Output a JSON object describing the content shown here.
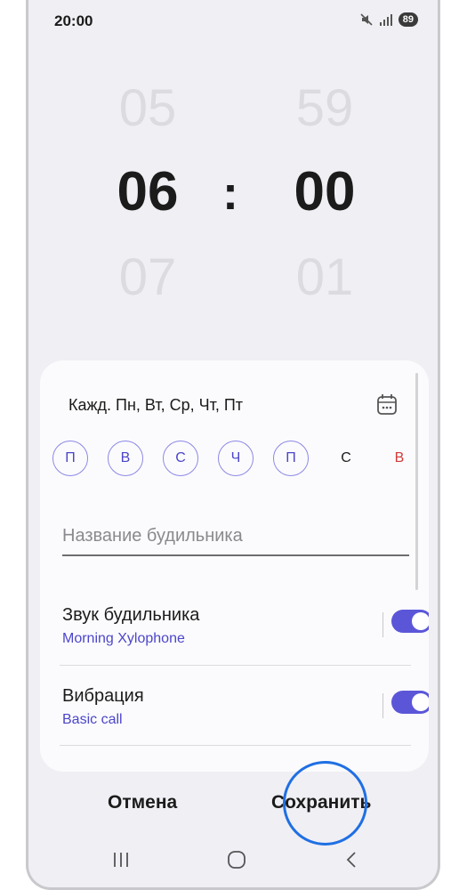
{
  "status_bar": {
    "time": "20:00",
    "battery": "89",
    "icons": [
      "mute-icon",
      "signal-icon",
      "battery-icon"
    ]
  },
  "time_picker": {
    "hours": {
      "prev": "05",
      "current": "06",
      "next": "07"
    },
    "separator": ":",
    "minutes": {
      "prev": "59",
      "current": "00",
      "next": "01"
    }
  },
  "repeat": {
    "summary": "Кажд. Пн, Вт, Ср, Чт, Пт",
    "calendar_icon": "calendar-icon"
  },
  "days": [
    {
      "label": "П",
      "selected": true
    },
    {
      "label": "В",
      "selected": true
    },
    {
      "label": "С",
      "selected": true
    },
    {
      "label": "Ч",
      "selected": true
    },
    {
      "label": "П",
      "selected": true
    },
    {
      "label": "С",
      "selected": false
    },
    {
      "label": "В",
      "selected": false
    }
  ],
  "alarm_name": {
    "placeholder": "Название будильника",
    "value": ""
  },
  "settings": [
    {
      "title": "Звук будильника",
      "subtitle": "Morning Xylophone",
      "enabled": true
    },
    {
      "title": "Вибрация",
      "subtitle": "Basic call",
      "enabled": true
    }
  ],
  "actions": {
    "cancel": "Отмена",
    "save": "Сохранить"
  },
  "navbar": {
    "icons": [
      "recent-apps-icon",
      "home-icon",
      "back-icon"
    ]
  },
  "colors": {
    "accent": "#5b56d8",
    "day_text": "#4c46c9",
    "sunday": "#d23b3b",
    "background": "#f0eff4",
    "card": "#fbfbfd",
    "tap_highlight": "#1f6fe3"
  }
}
